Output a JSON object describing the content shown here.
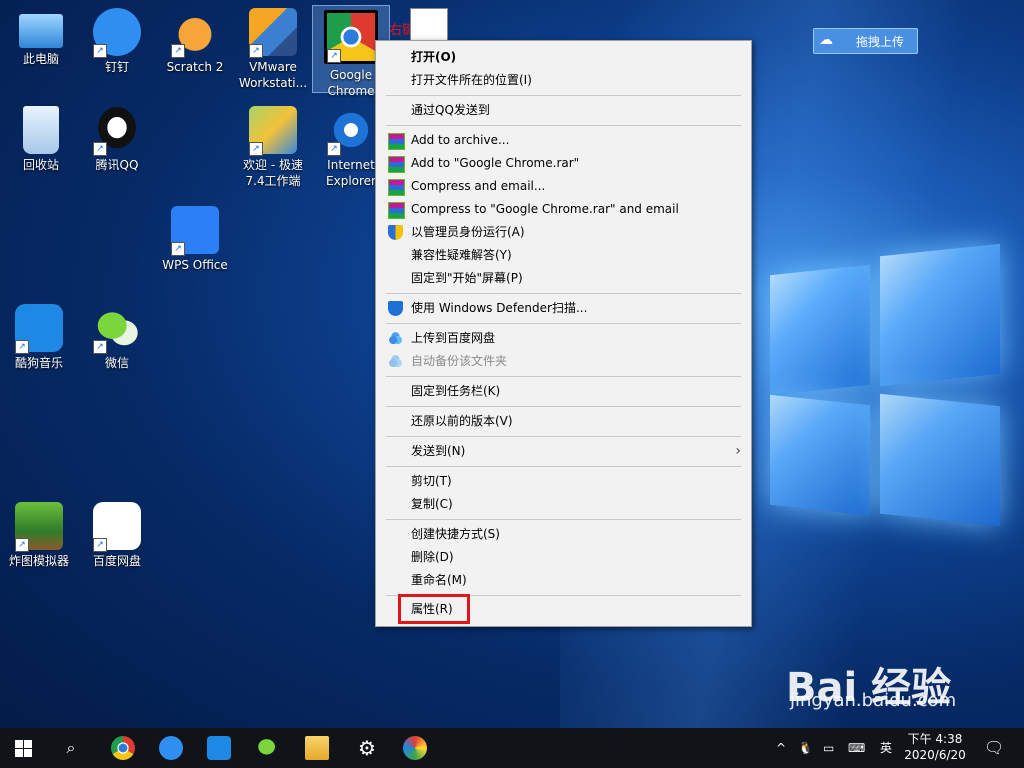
{
  "desktop_icons": [
    {
      "label": "此电脑",
      "icon": "computer-icon"
    },
    {
      "label": "钉钉",
      "icon": "dingtalk-icon"
    },
    {
      "label": "Scratch 2",
      "icon": "scratch-cat-icon"
    },
    {
      "label": "VMware Workstati...",
      "icon": "vmware-icon"
    },
    {
      "label": "Google Chrome",
      "icon": "chrome-icon"
    },
    {
      "label": "回收站",
      "icon": "recycle-bin-icon"
    },
    {
      "label": "腾讯QQ",
      "icon": "qq-penguin-icon"
    },
    {
      "label": "欢迎 - 极速 7.4工作端",
      "icon": "speed-tool-icon"
    },
    {
      "label": "Internet Explorer",
      "icon": "ie-icon"
    },
    {
      "label": "WPS Office",
      "icon": "wps-icon"
    },
    {
      "label": "酷狗音乐",
      "icon": "kugou-icon"
    },
    {
      "label": "微信",
      "icon": "wechat-icon"
    },
    {
      "label": "炸图模拟器",
      "icon": "game-icon"
    },
    {
      "label": "百度网盘",
      "icon": "baidu-netdisk-icon"
    }
  ],
  "annotation": {
    "text": "右键"
  },
  "context_menu": {
    "items": [
      {
        "label": "打开(O)",
        "bold": true
      },
      {
        "label": "打开文件所在的位置(I)"
      },
      {
        "label": "通过QQ发送到"
      },
      {
        "label": "Add to archive...",
        "icon": "winrar-icon"
      },
      {
        "label": "Add to \"Google Chrome.rar\"",
        "icon": "winrar-icon"
      },
      {
        "label": "Compress and email...",
        "icon": "winrar-icon"
      },
      {
        "label": "Compress to \"Google Chrome.rar\" and email",
        "icon": "winrar-icon"
      },
      {
        "label": "以管理员身份运行(A)",
        "icon": "uac-shield-icon"
      },
      {
        "label": "兼容性疑难解答(Y)"
      },
      {
        "label": "固定到\"开始\"屏幕(P)"
      },
      {
        "label": "使用 Windows Defender扫描...",
        "icon": "defender-icon"
      },
      {
        "label": "上传到百度网盘",
        "icon": "baidu-cloud-icon"
      },
      {
        "label": "自动备份该文件夹",
        "icon": "baidu-cloud-icon",
        "disabled": true
      },
      {
        "label": "固定到任务栏(K)"
      },
      {
        "label": "还原以前的版本(V)"
      },
      {
        "label": "发送到(N)",
        "submenu": true
      },
      {
        "label": "剪切(T)"
      },
      {
        "label": "复制(C)"
      },
      {
        "label": "创建快捷方式(S)"
      },
      {
        "label": "删除(D)"
      },
      {
        "label": "重命名(M)"
      },
      {
        "label": "属性(R)",
        "highlighted": true
      }
    ],
    "submenu_glyph": "›"
  },
  "upload_widget": {
    "label": "拖拽上传",
    "icon": "cloud-icon"
  },
  "taskbar": {
    "items": [
      "start-icon",
      "search-icon",
      "chrome-icon",
      "dingtalk-icon",
      "phone-icon",
      "wechat-icon",
      "file-explorer-icon",
      "settings-icon",
      "paint-icon"
    ],
    "tray_chevron": "^",
    "ime": "英",
    "time": "下午 4:38",
    "date": "2020/6/20"
  },
  "watermark": {
    "brand": "Bai 经验",
    "url": "jingyan.baidu.com"
  },
  "colors": {
    "highlight_border": "#e0161a",
    "menu_bg": "#f2f2f2",
    "taskbar_bg": "#101418"
  }
}
